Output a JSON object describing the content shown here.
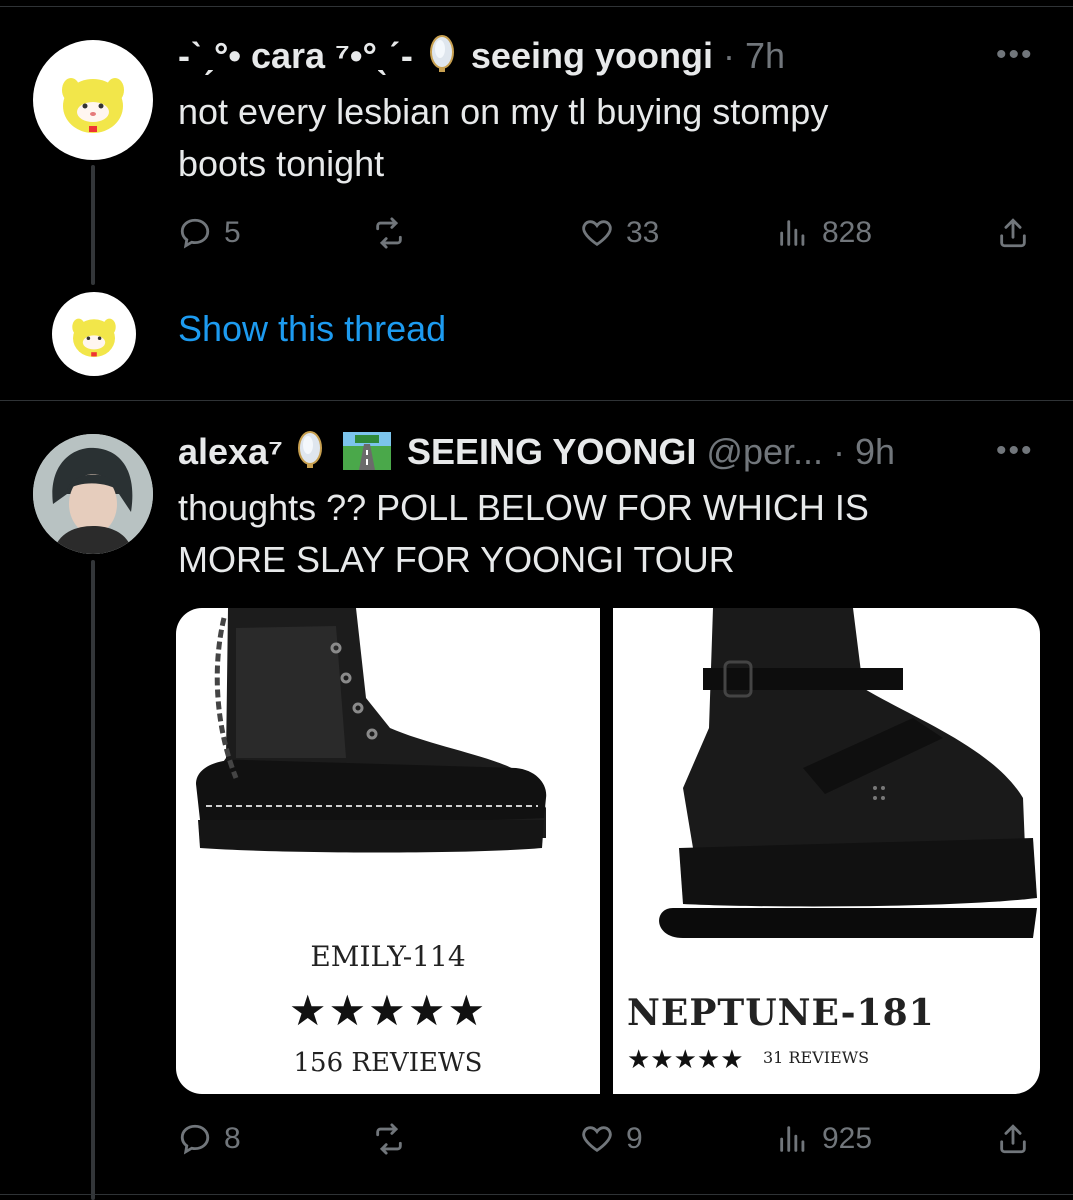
{
  "tweet1": {
    "display_name": "-ˋˏ°• cara ⁷•°ˎˊ-",
    "badge_icon": "mirror-icon",
    "name_suffix": "seeing yoongi",
    "time": "· 7h",
    "text_line1": "not every lesbian on my tl buying stompy",
    "text_line2": "boots tonight",
    "replies": "5",
    "likes": "33",
    "views": "828",
    "avatar_color": "#f5e639"
  },
  "show_thread": {
    "label": "Show this thread"
  },
  "tweet2": {
    "display_name": "alexa⁷",
    "badge_icon": "mirror-icon",
    "road_icon": "motorway-icon",
    "name_suffix": "SEEING YOONGI",
    "handle": "@per...",
    "time": "· 9h",
    "text_line1": "thoughts ?? POLL BELOW FOR WHICH IS",
    "text_line2": "MORE SLAY FOR YOONGI TOUR",
    "replies": "8",
    "likes": "9",
    "views": "925",
    "products": [
      {
        "name": "EMILY-114",
        "stars": "★★★★★",
        "reviews": "156 REVIEWS"
      },
      {
        "name": "NEPTUNE-181",
        "stars": "★★★★★",
        "reviews": "31 REVIEWS"
      }
    ]
  },
  "colors": {
    "link": "#1d9bf0",
    "muted": "#71767b",
    "text": "#e7e9ea"
  }
}
